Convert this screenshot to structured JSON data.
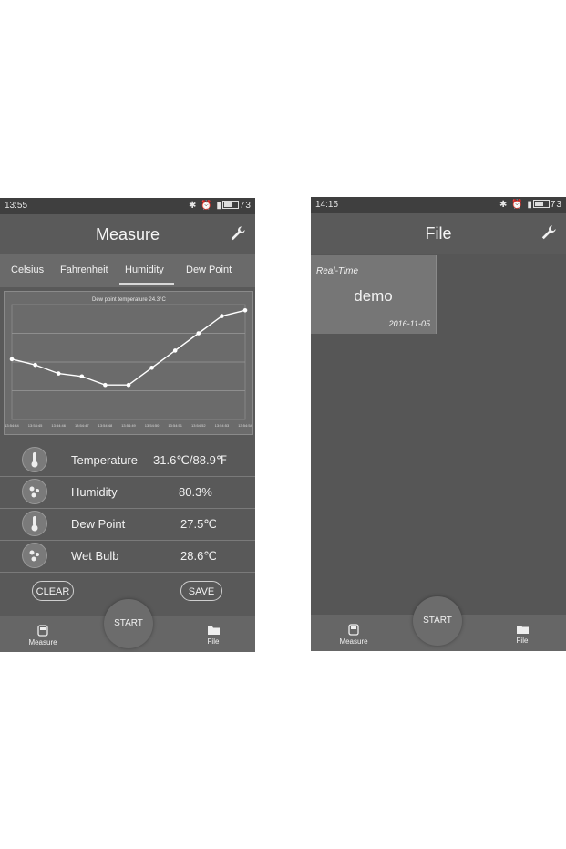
{
  "left_screen": {
    "status": {
      "time": "13:55",
      "battery": "73"
    },
    "header": {
      "title": "Measure"
    },
    "tabs": [
      "Celsius",
      "Fahrenheit",
      "Humidity",
      "Dew Point"
    ],
    "chart_data": {
      "type": "line",
      "title": "Dew point temperature 24.3°C",
      "ylabel": "",
      "xlabel": "",
      "x": [
        "13:54:44",
        "13:54:45",
        "13:54:46",
        "13:54:47",
        "13:54:48",
        "13:54:49",
        "13:54:50",
        "13:54:51",
        "13:54:52",
        "13:54:53",
        "13:54:54"
      ],
      "series": [
        {
          "values": [
            24.1,
            23.9,
            23.6,
            23.5,
            23.2,
            23.2,
            23.8,
            24.4,
            25.0,
            25.6,
            25.8
          ]
        }
      ],
      "ylim": [
        22,
        26
      ],
      "grid": true,
      "color": "#ffffff"
    },
    "readings": [
      {
        "label": "Temperature",
        "value": "31.6℃/88.9℉",
        "icon": "thermometer-icon"
      },
      {
        "label": "Humidity",
        "value": "80.3%",
        "icon": "humidity-drops-icon"
      },
      {
        "label": "Dew Point",
        "value": "27.5℃",
        "icon": "thermometer-icon"
      },
      {
        "label": "Wet Bulb",
        "value": "28.6℃",
        "icon": "humidity-drops-icon"
      }
    ],
    "buttons": {
      "clear": "CLEAR",
      "save": "SAVE",
      "start": "START"
    },
    "nav": {
      "measure": "Measure",
      "file": "File"
    }
  },
  "right_screen": {
    "status": {
      "time": "14:15",
      "battery": "73"
    },
    "header": {
      "title": "File"
    },
    "file_item": {
      "kind": "Real-Time",
      "name": "demo",
      "date": "2016-11-05"
    },
    "buttons": {
      "start": "START"
    },
    "nav": {
      "measure": "Measure",
      "file": "File"
    }
  }
}
